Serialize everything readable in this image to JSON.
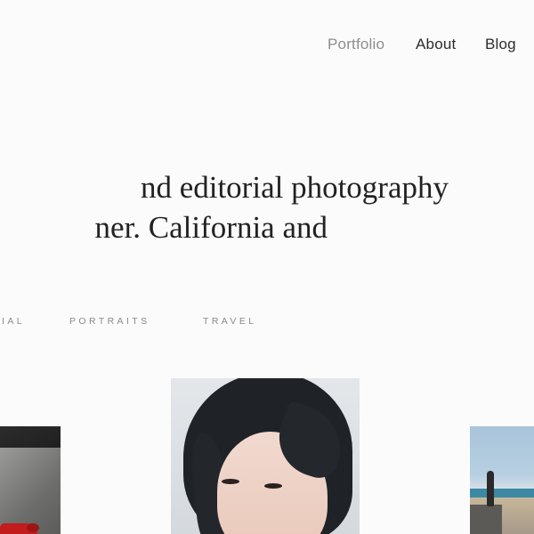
{
  "nav": {
    "items": [
      {
        "label": "Portfolio",
        "active": true
      },
      {
        "label": "About",
        "active": false
      },
      {
        "label": "Blog",
        "active": false
      }
    ]
  },
  "hero": {
    "line1": "nd editorial photography",
    "line2": "ner. California and"
  },
  "filters": {
    "items": [
      {
        "label": "IAL"
      },
      {
        "label": "PORTRAITS"
      },
      {
        "label": "TRAVEL"
      }
    ]
  },
  "colors": {
    "background": "#fbfbfb",
    "text": "#222222",
    "nav_active": "#8d8d8d",
    "filter_text": "#8a8a8a"
  }
}
